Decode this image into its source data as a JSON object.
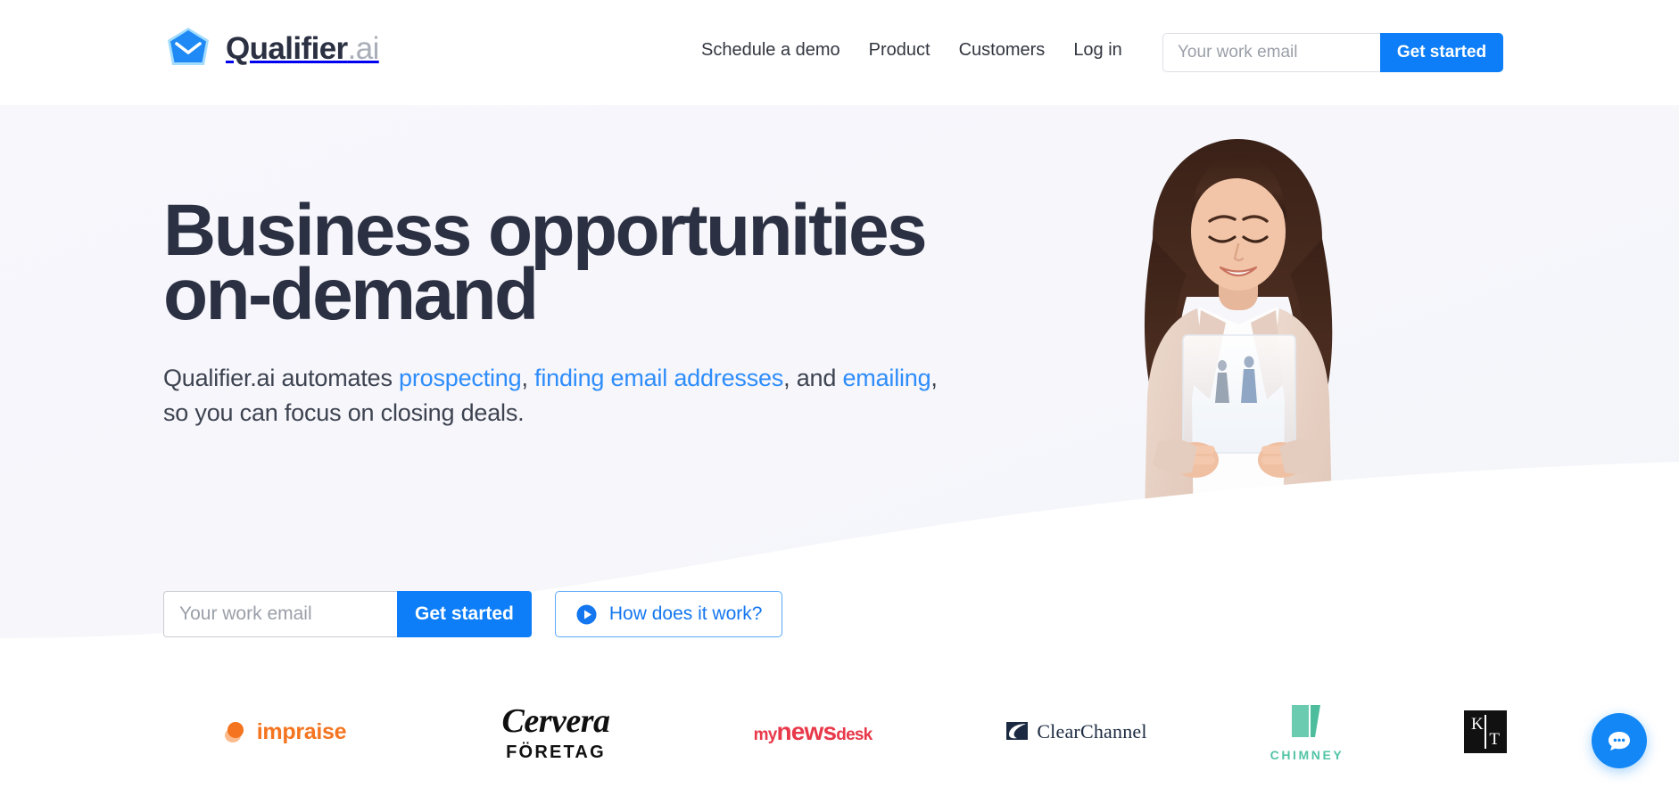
{
  "brand": {
    "name": "Qualifier",
    "suffix": ".ai",
    "logo_icon": "envelope-logo-icon",
    "color": "#1f8af5"
  },
  "header": {
    "nav": [
      {
        "label": "Schedule a demo",
        "name": "nav-schedule-demo"
      },
      {
        "label": "Product",
        "name": "nav-product"
      },
      {
        "label": "Customers",
        "name": "nav-customers"
      },
      {
        "label": "Log in",
        "name": "nav-log-in"
      }
    ],
    "email_placeholder": "Your work email",
    "email_value": "",
    "cta_label": "Get started",
    "cta_color": "#0d7ef7"
  },
  "hero": {
    "headline_line1": "Business opportunities",
    "headline_line2": "on-demand",
    "headline_color": "#2b3042",
    "subhead": {
      "part1": "Qualifier.ai automates ",
      "link1": "prospecting",
      "part2": ", ",
      "link2": "finding email addresses",
      "part3": ", and ",
      "link3": "emailing",
      "part4": ", so you can focus on closing deals.",
      "link_color": "#2e8dfb"
    },
    "email_placeholder": "Your work email",
    "email_value": "",
    "cta_label": "Get started",
    "video_label": "How does it work?",
    "video_icon": "play-circle-icon",
    "photo_alt": "smiling-woman-holding-tablet",
    "background_color": "#f7f7fc"
  },
  "logos": [
    {
      "name": "logo-impraise",
      "label": "impraise",
      "color": "#f4741f"
    },
    {
      "name": "logo-cervera",
      "label": "Cervera",
      "sub": "FÖRETAG",
      "color": "#101010"
    },
    {
      "name": "logo-mynewsdesk",
      "prefix": "my",
      "main": "news",
      "suffix": "desk",
      "color": "#e8394a"
    },
    {
      "name": "logo-clearchannel",
      "label": "ClearChannel",
      "color": "#1b2a41"
    },
    {
      "name": "logo-chimney",
      "label": "CHIMNEY",
      "color": "#53c4a6"
    },
    {
      "name": "logo-kit",
      "letter1": "K",
      "letter2": "T",
      "color": "#111111"
    }
  ],
  "chat": {
    "icon": "chat-bubble-icon",
    "color": "#1287f5"
  }
}
